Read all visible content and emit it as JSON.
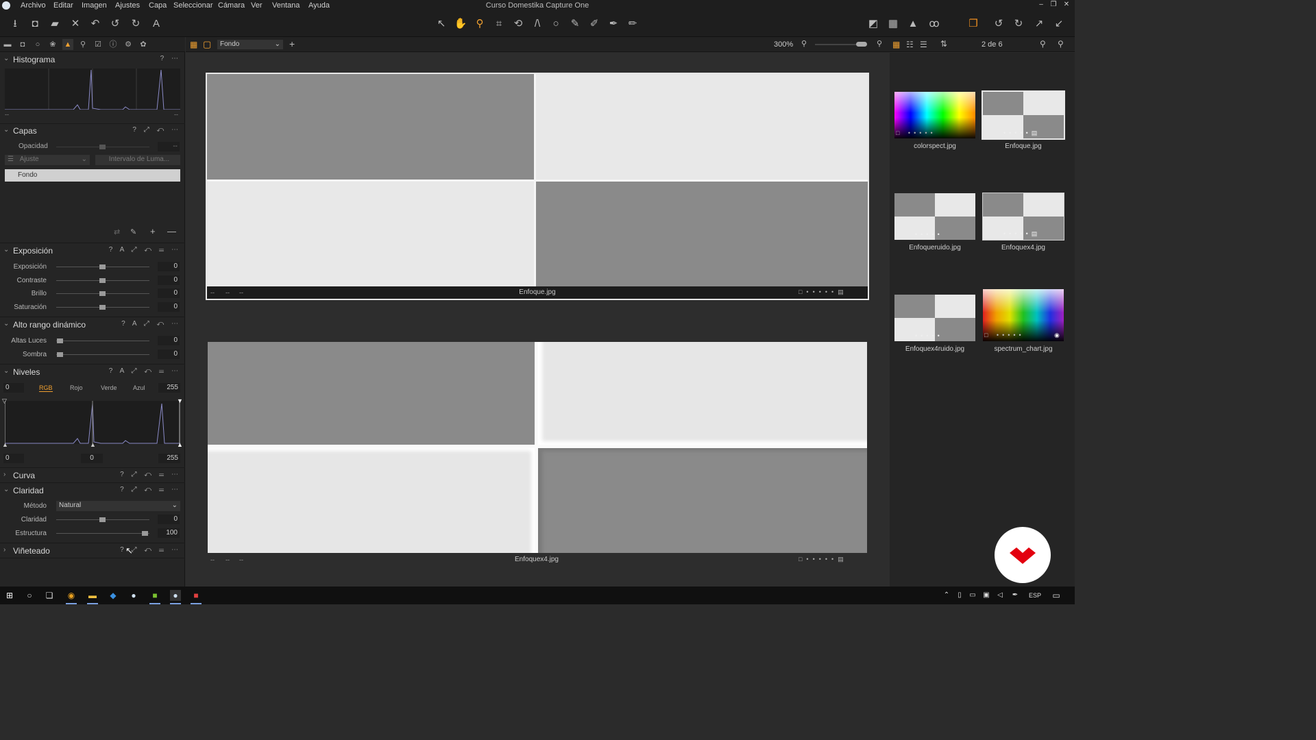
{
  "window": {
    "title": "Curso Domestika Capture One"
  },
  "menu": [
    "Archivo",
    "Editar",
    "Imagen",
    "Ajustes",
    "Capa",
    "Seleccionar",
    "Cámara",
    "Ver",
    "Ventana",
    "Ayuda"
  ],
  "center_bar": {
    "variant": "Fondo",
    "zoom": "300%"
  },
  "right_bar": {
    "counter": "2 de 6"
  },
  "panels": {
    "histograma": {
      "title": "Histograma",
      "left_val": "--",
      "right_val": "--"
    },
    "capas": {
      "title": "Capas",
      "opacity_label": "Opacidad",
      "opacity_value": "--",
      "adjust_dropdown": "Ajuste",
      "luma_button": "Intervalo de Luma...",
      "layer_name": "Fondo"
    },
    "exposicion": {
      "title": "Exposición",
      "sliders": [
        {
          "label": "Exposición",
          "value": "0"
        },
        {
          "label": "Contraste",
          "value": "0"
        },
        {
          "label": "Brillo",
          "value": "0"
        },
        {
          "label": "Saturación",
          "value": "0"
        }
      ]
    },
    "hdr": {
      "title": "Alto rango dinámico",
      "sliders": [
        {
          "label": "Altas Luces",
          "value": "0"
        },
        {
          "label": "Sombra",
          "value": "0"
        }
      ]
    },
    "niveles": {
      "title": "Niveles",
      "channels": [
        "RGB",
        "Rojo",
        "Verde",
        "Azul"
      ],
      "active_channel": "RGB",
      "input_low": "0",
      "input_high": "255",
      "output_low": "0",
      "output_mid": "0",
      "output_high": "255"
    },
    "curva": {
      "title": "Curva"
    },
    "claridad": {
      "title": "Claridad",
      "method_label": "Método",
      "method_value": "Natural",
      "sliders": [
        {
          "label": "Claridad",
          "value": "0"
        },
        {
          "label": "Estructura",
          "value": "100"
        }
      ]
    },
    "vineteado": {
      "title": "Viñeteado"
    }
  },
  "viewer": {
    "images": [
      {
        "caption": "Enfoque.jpg",
        "meta": [
          "--",
          "--",
          "--"
        ]
      },
      {
        "caption": "Enfoquex4.jpg",
        "meta": [
          "--",
          "--",
          "--"
        ]
      }
    ]
  },
  "browser": {
    "thumbs": [
      {
        "name": "colorspect.jpg"
      },
      {
        "name": "Enfoque.jpg"
      },
      {
        "name": "Enfoqueruido.jpg"
      },
      {
        "name": "Enfoquex4.jpg"
      },
      {
        "name": "Enfoquex4ruido.jpg"
      },
      {
        "name": "spectrum_chart.jpg"
      }
    ]
  },
  "taskbar": {
    "lang": "ESP"
  },
  "colors": {
    "accent": "#f0a030",
    "panel": "#252525",
    "viewer": "#2d2d2d",
    "grey_dark": "#8a8a8a",
    "grey_light": "#e8e8e8"
  }
}
